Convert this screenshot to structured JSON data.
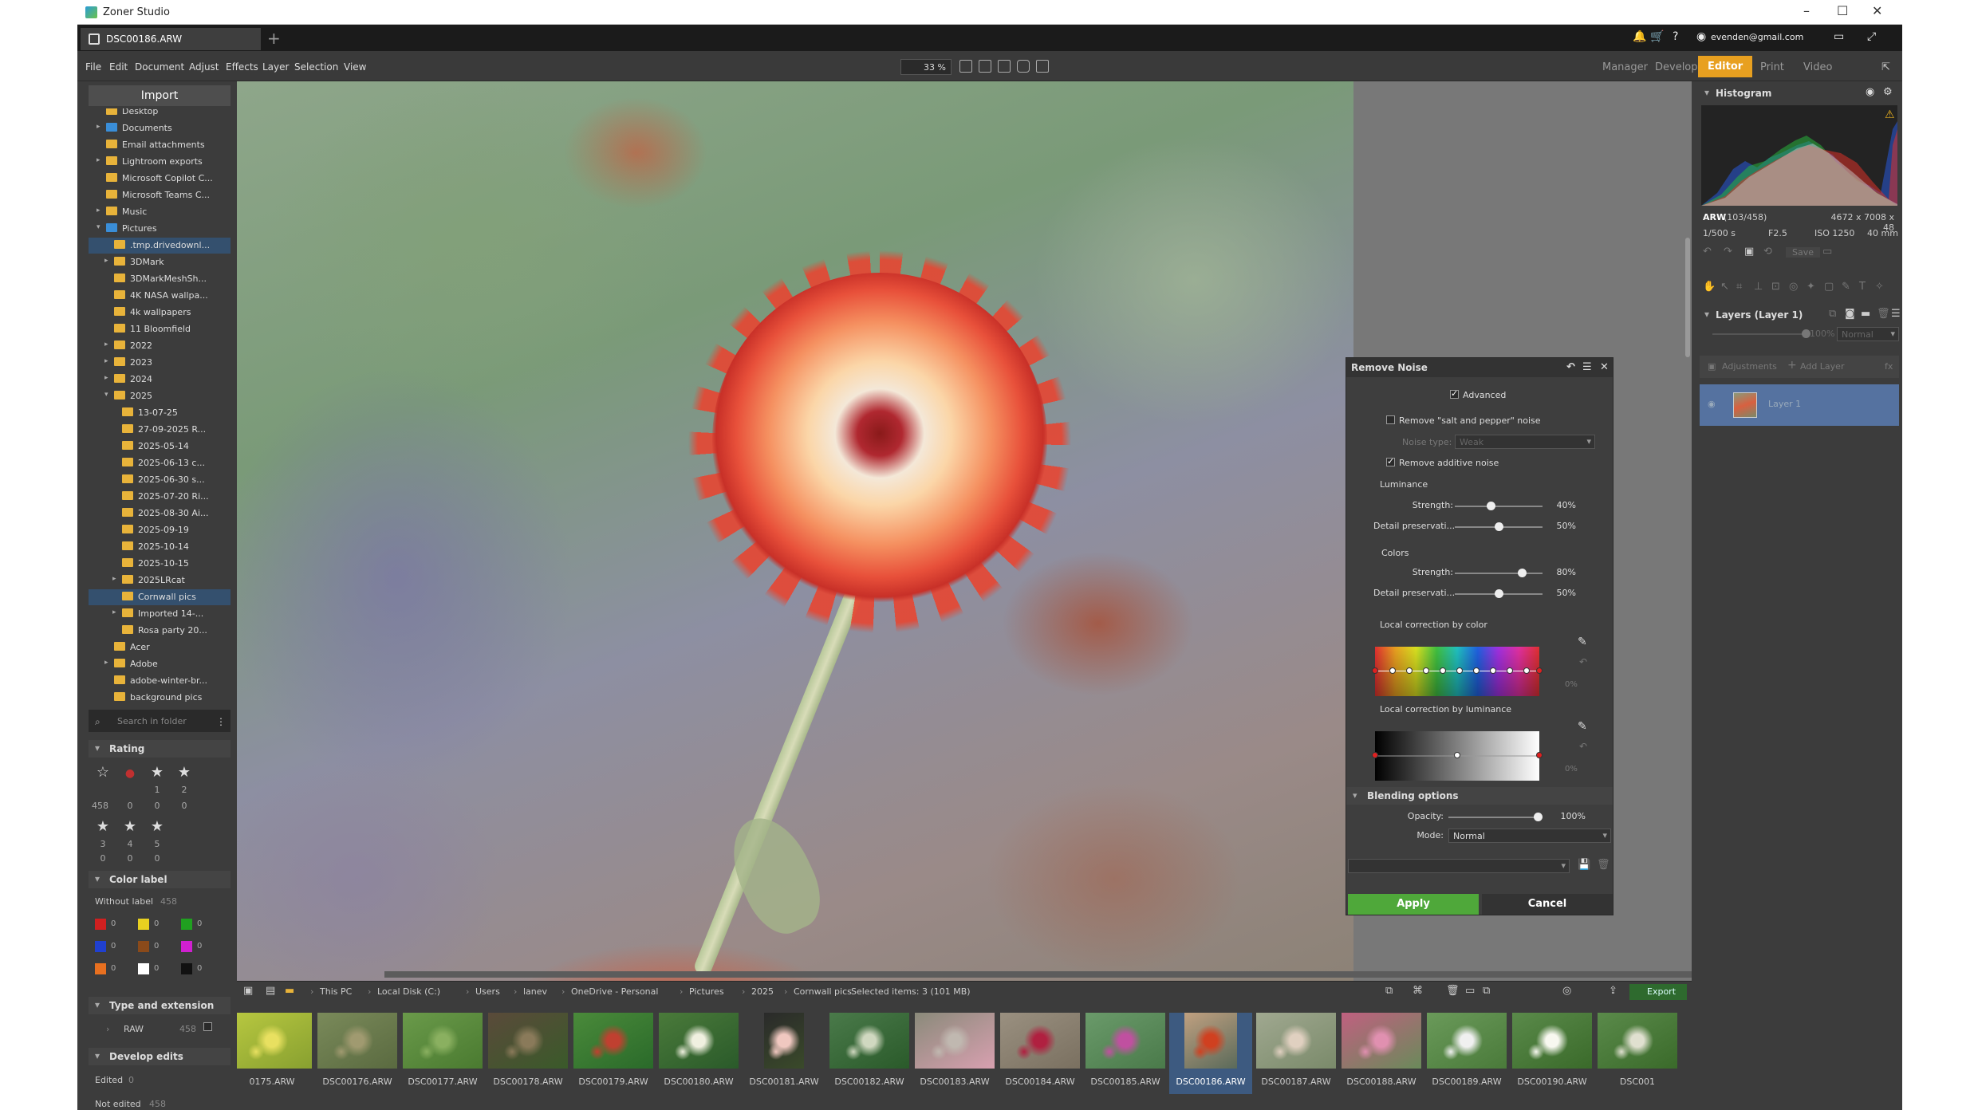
{
  "app": {
    "title": "Zoner Studio",
    "tab": "DSC00186.ARW",
    "user": "evenden@gmail.com"
  },
  "menu": [
    "File",
    "Edit",
    "Document",
    "Adjust",
    "Effects",
    "Layer",
    "Selection",
    "View"
  ],
  "zoom": "33 %",
  "modes": [
    "Manager",
    "Develop",
    "Editor",
    "Print",
    "Video"
  ],
  "active_mode": "Editor",
  "left": {
    "import": "Import",
    "tree": [
      {
        "l": "Desktop",
        "d": 1
      },
      {
        "l": "Documents",
        "d": 1,
        "b": true,
        "a": "▸"
      },
      {
        "l": "Email attachments",
        "d": 1
      },
      {
        "l": "Lightroom exports",
        "d": 1,
        "a": "▸"
      },
      {
        "l": "Microsoft Copilot C...",
        "d": 1
      },
      {
        "l": "Microsoft Teams C...",
        "d": 1
      },
      {
        "l": "Music",
        "d": 1,
        "a": "▸"
      },
      {
        "l": "Pictures",
        "d": 1,
        "b": true,
        "a": "▾"
      },
      {
        "l": ".tmp.drivedownl...",
        "d": 2,
        "sel": true
      },
      {
        "l": "3DMark",
        "d": 2,
        "a": "▸"
      },
      {
        "l": "3DMarkMeshSh...",
        "d": 2
      },
      {
        "l": "4K NASA wallpa...",
        "d": 2
      },
      {
        "l": "4k wallpapers",
        "d": 2
      },
      {
        "l": "11 Bloomfield",
        "d": 2
      },
      {
        "l": "2022",
        "d": 2,
        "a": "▸"
      },
      {
        "l": "2023",
        "d": 2,
        "a": "▸"
      },
      {
        "l": "2024",
        "d": 2,
        "a": "▸"
      },
      {
        "l": "2025",
        "d": 2,
        "a": "▾"
      },
      {
        "l": "13-07-25",
        "d": 3
      },
      {
        "l": "27-09-2025 R...",
        "d": 3
      },
      {
        "l": "2025-05-14",
        "d": 3
      },
      {
        "l": "2025-06-13 c...",
        "d": 3
      },
      {
        "l": "2025-06-30 s...",
        "d": 3
      },
      {
        "l": "2025-07-20 Ri...",
        "d": 3
      },
      {
        "l": "2025-08-30 Ai...",
        "d": 3
      },
      {
        "l": "2025-09-19",
        "d": 3
      },
      {
        "l": "2025-10-14",
        "d": 3
      },
      {
        "l": "2025-10-15",
        "d": 3
      },
      {
        "l": "2025LRcat",
        "d": 3,
        "a": "▸"
      },
      {
        "l": "Cornwall pics",
        "d": 3,
        "sel": true
      },
      {
        "l": "Imported 14-...",
        "d": 3,
        "a": "▸"
      },
      {
        "l": "Rosa party 20...",
        "d": 3
      },
      {
        "l": "Acer",
        "d": 2
      },
      {
        "l": "Adobe",
        "d": 2,
        "a": "▸"
      },
      {
        "l": "adobe-winter-br...",
        "d": 2
      },
      {
        "l": "background pics",
        "d": 2
      }
    ],
    "search_placeholder": "Search in folder",
    "rating_title": "Rating",
    "rating_row1": {
      "labels": [
        "",
        "",
        "1",
        "2"
      ],
      "counts": [
        "458",
        "0",
        "0",
        "0"
      ]
    },
    "rating_row2": {
      "labels": [
        "3",
        "4",
        "5"
      ],
      "counts": [
        "0",
        "0",
        "0"
      ]
    },
    "color_label_title": "Color label",
    "without_label": "Without label",
    "without_label_count": "458",
    "colors": [
      {
        "c": "#d02020",
        "n": "0"
      },
      {
        "c": "#e8d020",
        "n": "0"
      },
      {
        "c": "#20a020",
        "n": "0"
      },
      {
        "c": "#2040d0",
        "n": "0"
      },
      {
        "c": "#8a4a1a",
        "n": "0"
      },
      {
        "c": "#d020d0",
        "n": "0"
      },
      {
        "c": "#e87020",
        "n": "0"
      },
      {
        "c": "#ffffff",
        "n": "0"
      },
      {
        "c": "#111111",
        "n": "0"
      }
    ],
    "type_title": "Type and extension",
    "raw_label": "RAW",
    "raw_count": "458",
    "develop_title": "Develop edits",
    "edited": "Edited",
    "edited_count": "0",
    "not_edited": "Not edited",
    "not_edited_count": "458"
  },
  "remove_noise": {
    "title": "Remove Noise",
    "advanced": "Advanced",
    "salt_pepper": "Remove \"salt and pepper\" noise",
    "noise_type_label": "Noise type:",
    "noise_type": "Weak",
    "additive": "Remove additive noise",
    "luminance": "Luminance",
    "strength_label": "Strength:",
    "lum_strength": "40%",
    "lum_strength_v": 40,
    "detail_label": "Detail preservati...",
    "lum_detail": "50%",
    "lum_detail_v": 50,
    "colors": "Colors",
    "col_strength": "80%",
    "col_strength_v": 80,
    "col_detail": "50%",
    "col_detail_v": 50,
    "local_color": "Local correction by color",
    "local_lum": "Local correction by luminance",
    "zero_pct": "0%",
    "blending": "Blending options",
    "opacity_label": "Opacity:",
    "opacity": "100%",
    "opacity_v": 100,
    "mode_label": "Mode:",
    "mode": "Normal",
    "apply": "Apply",
    "cancel": "Cancel"
  },
  "right": {
    "histogram": "Histogram",
    "format": "ARW",
    "index": "(103/458)",
    "dims": "4672 x 7008 x 48",
    "shutter": "1/500 s",
    "aperture": "F2.5",
    "iso": "ISO 1250",
    "focal": "40 mm",
    "save": "Save",
    "layers_title": "Layers (Layer 1)",
    "layer_opacity": "100%",
    "layer_mode": "Normal",
    "adjustments": "Adjustments",
    "add_layer": "Add Layer",
    "fx": "fx",
    "layer1": "Layer 1"
  },
  "path": {
    "crumbs": [
      "This PC",
      "Local Disk (C:)",
      "Users",
      "lanev",
      "OneDrive - Personal",
      "Pictures",
      "2025",
      "Cornwall pics"
    ],
    "selected": "Selected items: 3 (101 MB)",
    "export": "Export"
  },
  "thumbs": [
    "0175.ARW",
    "DSC00176.ARW",
    "DSC00177.ARW",
    "DSC00178.ARW",
    "DSC00179.ARW",
    "DSC00180.ARW",
    "DSC00181.ARW",
    "DSC00182.ARW",
    "DSC00183.ARW",
    "DSC00184.ARW",
    "DSC00185.ARW",
    "DSC00186.ARW",
    "DSC00187.ARW",
    "DSC00188.ARW",
    "DSC00189.ARW",
    "DSC00190.ARW",
    "DSC001"
  ],
  "selected_thumb": 11
}
